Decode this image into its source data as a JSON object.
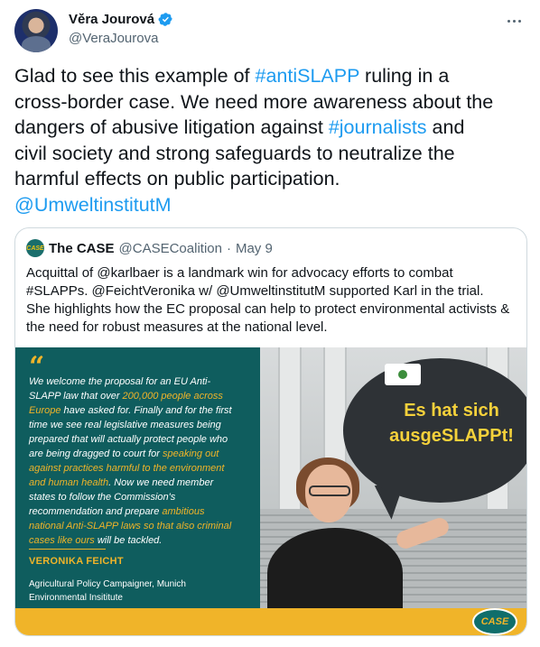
{
  "author": {
    "display_name": "Věra Jourová",
    "handle": "@VeraJourova",
    "avatar_icon": "profile-photo",
    "verified_icon": "verified-badge-icon",
    "more_icon": "more-options-icon"
  },
  "tweet": {
    "lines": [
      {
        "a": "Glad to see this example of ",
        "link": "#antiSLAPP",
        "b": " ruling in a"
      },
      {
        "a": "cross-border case. We need more awareness about the",
        "link": "",
        "b": ""
      },
      {
        "a": "dangers of abusive litigation against ",
        "link": "#journalists",
        "b": " and"
      },
      {
        "a": "civil society and strong safeguards to neutralize the",
        "link": "",
        "b": ""
      },
      {
        "a": "harmful effects on public participation.",
        "link": "",
        "b": ""
      },
      {
        "a": "",
        "link": "@UmweltinstitutM",
        "b": ""
      }
    ]
  },
  "quoted": {
    "avatar_text": "CASE",
    "name": "The CASE",
    "handle": "@CASECoalition",
    "separator": "·",
    "date": "May 9",
    "lines": [
      "Acquittal of @karlbaer is a landmark win for advocacy efforts to combat",
      "#SLAPPs. @FeichtVeronika w/ @UmweltinstitutM supported Karl in the trial.",
      "She highlights how the EC proposal can help to protect environmental activists &",
      "the need for robust measures at the national level."
    ],
    "image": {
      "quote_mark": "“",
      "statement_lines": [
        [
          {
            "t": "We welcome the proposal for an EU Anti-",
            "h": false
          }
        ],
        [
          {
            "t": "SLAPP law that over ",
            "h": false
          },
          {
            "t": "200,000 people across",
            "h": true
          }
        ],
        [
          {
            "t": "Europe",
            "h": true
          },
          {
            "t": " have asked for. Finally and for the first",
            "h": false
          }
        ],
        [
          {
            "t": "time we see real legislative measures being",
            "h": false
          }
        ],
        [
          {
            "t": "prepared that will actually protect people who",
            "h": false
          }
        ],
        [
          {
            "t": "are being dragged to court for ",
            "h": false
          },
          {
            "t": "speaking out",
            "h": true
          }
        ],
        [
          {
            "t": "against practices harmful to the environment",
            "h": true
          }
        ],
        [
          {
            "t": "and human health",
            "h": true
          },
          {
            "t": ". Now we need member",
            "h": false
          }
        ],
        [
          {
            "t": "states to follow the Commission's",
            "h": false
          }
        ],
        [
          {
            "t": "recommendation and prepare ",
            "h": false
          },
          {
            "t": "ambitious",
            "h": true
          }
        ],
        [
          {
            "t": "national Anti-SLAPP laws so that also criminal",
            "h": true
          }
        ],
        [
          {
            "t": "cases like ours",
            "h": true
          },
          {
            "t": " will be tackled.",
            "h": false
          }
        ]
      ],
      "speaker": "VERONIKA FEICHT",
      "role_lines": [
        "Agricultural Policy Campaigner, Munich",
        "Environmental Insititute"
      ],
      "sign_lines": [
        "Es hat sich",
        "ausgeSLAPPt!"
      ],
      "footer_logo": "CASE"
    }
  },
  "colors": {
    "link": "#1d9bf0",
    "teal": "#0f5d5e",
    "accent_yellow": "#f0b429"
  }
}
